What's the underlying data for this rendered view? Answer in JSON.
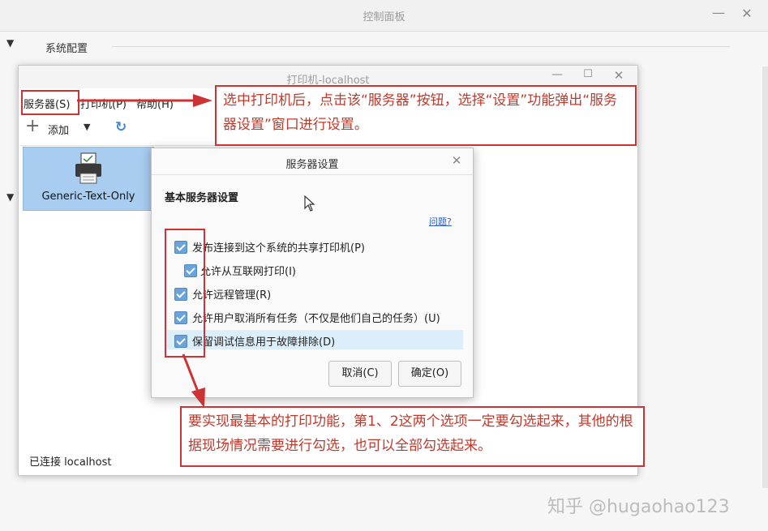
{
  "control_panel": {
    "title": "控制面板",
    "minimize_glyph": "—",
    "close_glyph": "✕",
    "section_toggle_glyph": "▼",
    "section_system_config": "系统配置"
  },
  "printer_window": {
    "title": "打印机-localhost",
    "minimize_glyph": "—",
    "maximize_glyph": "☐",
    "close_glyph": "✕",
    "menu": [
      "服务器(S)",
      "打印机(P)",
      "帮助(H)"
    ],
    "toolbar": {
      "add_label": "添加",
      "add_icon": "plus-icon",
      "dropdown_icon": "triangle-down-icon",
      "refresh_icon": "refresh-icon"
    },
    "printer": {
      "name": "Generic-Text-Only",
      "icon": "printer-icon"
    },
    "status": "已连接 localhost"
  },
  "server_settings_dialog": {
    "title": "服务器设置",
    "close_glyph": "✕",
    "heading": "基本服务器设置",
    "help_link": "问题?",
    "options": [
      {
        "label": "发布连接到这个系统的共享打印机(P)",
        "checked": true
      },
      {
        "label": "允许从互联网打印(I)",
        "checked": true
      },
      {
        "label": "允许远程管理(R)",
        "checked": true
      },
      {
        "label": "允许用户取消所有任务（不仅是他们自己的任务）(U)",
        "checked": true
      },
      {
        "label": "保留调试信息用于故障排除(D)",
        "checked": true
      }
    ],
    "cancel_button": "取消(C)",
    "ok_button": "确定(O)"
  },
  "annotations": {
    "note_top": "选中打印机后，点击该“服务器”按钮，选择“设置”功能弹出“服务器设置”窗口进行设置。",
    "note_bottom": "要实现最基本的打印功能，第1、2这两个选项一定要勾选起来，其他的根据现场情况需要进行勾选，也可以全部勾选起来。",
    "color": "#cc3333"
  },
  "watermark": "知乎 @hugaohao123"
}
